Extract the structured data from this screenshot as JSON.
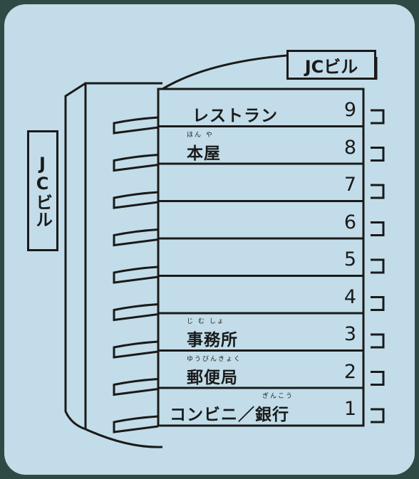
{
  "signs": {
    "top": "JCビル",
    "side": "JCビル"
  },
  "floors": [
    {
      "number": "9",
      "label": "レストラン",
      "ruby": ""
    },
    {
      "number": "8",
      "label": "本屋",
      "ruby": "ほん や"
    },
    {
      "number": "7",
      "label": "",
      "ruby": ""
    },
    {
      "number": "6",
      "label": "",
      "ruby": ""
    },
    {
      "number": "5",
      "label": "",
      "ruby": ""
    },
    {
      "number": "4",
      "label": "",
      "ruby": ""
    },
    {
      "number": "3",
      "label": "事務所",
      "ruby": "じ む しょ"
    },
    {
      "number": "2",
      "label": "郵便局",
      "ruby": "ゆうびんきょく"
    },
    {
      "number": "1",
      "label": "コンビニ／銀行",
      "ruby": "ぎんこう"
    }
  ],
  "colors": {
    "panel": "#c2dde9",
    "line": "#1a1a1a",
    "frame": "#2f4a44"
  }
}
